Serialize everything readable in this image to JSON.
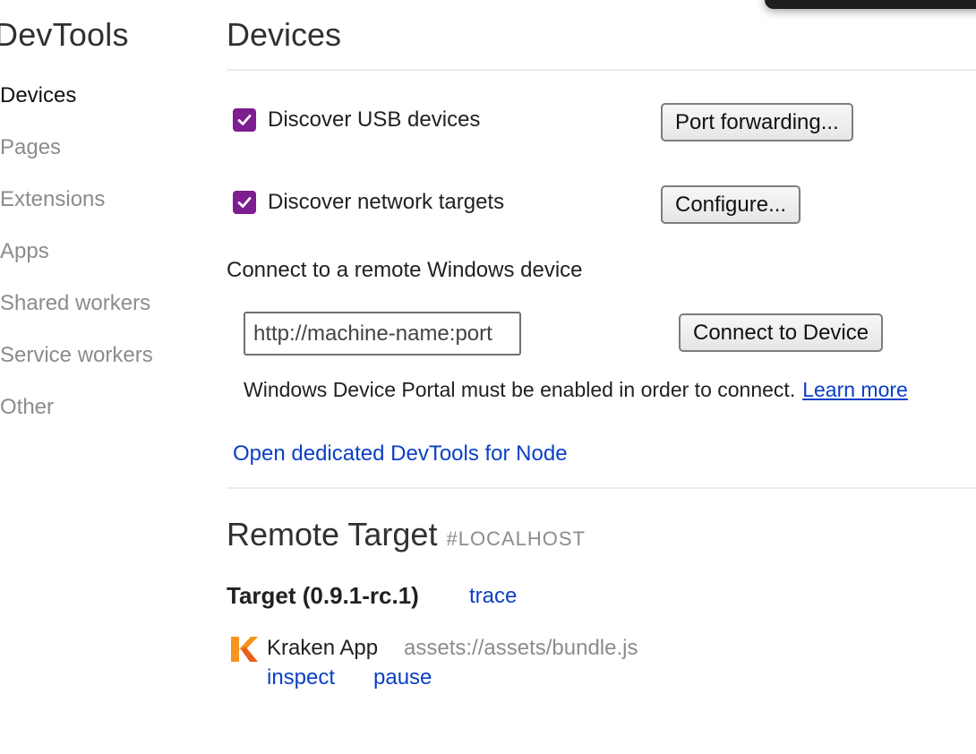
{
  "sidebar": {
    "title": "DevTools",
    "items": [
      {
        "label": "Devices",
        "active": true
      },
      {
        "label": "Pages",
        "active": false
      },
      {
        "label": "Extensions",
        "active": false
      },
      {
        "label": "Apps",
        "active": false
      },
      {
        "label": "Shared workers",
        "active": false
      },
      {
        "label": "Service workers",
        "active": false
      },
      {
        "label": "Other",
        "active": false
      }
    ]
  },
  "main": {
    "title": "Devices",
    "usb": {
      "label": "Discover USB devices",
      "checked": true,
      "button": "Port forwarding..."
    },
    "network": {
      "label": "Discover network targets",
      "checked": true,
      "button": "Configure..."
    },
    "remote_windows": {
      "label": "Connect to a remote Windows device",
      "placeholder": "http://machine-name:port",
      "button": "Connect to Device",
      "note": "Windows Device Portal must be enabled in order to connect.",
      "note_link": "Learn more"
    },
    "node_link": "Open dedicated DevTools for Node"
  },
  "remote": {
    "title": "Remote Target",
    "host": "#LOCALHOST",
    "target": {
      "name": "Target (0.9.1-rc.1)",
      "trace_label": "trace"
    },
    "app": {
      "name": "Kraken App",
      "url": "assets://assets/bundle.js",
      "inspect_label": "inspect",
      "pause_label": "pause"
    }
  },
  "colors": {
    "accent_checkbox": "#7d1d8f",
    "link": "#0b3fc4",
    "muted_text": "#8a8c8e",
    "kraken_icon_orange": "#f7931e"
  }
}
